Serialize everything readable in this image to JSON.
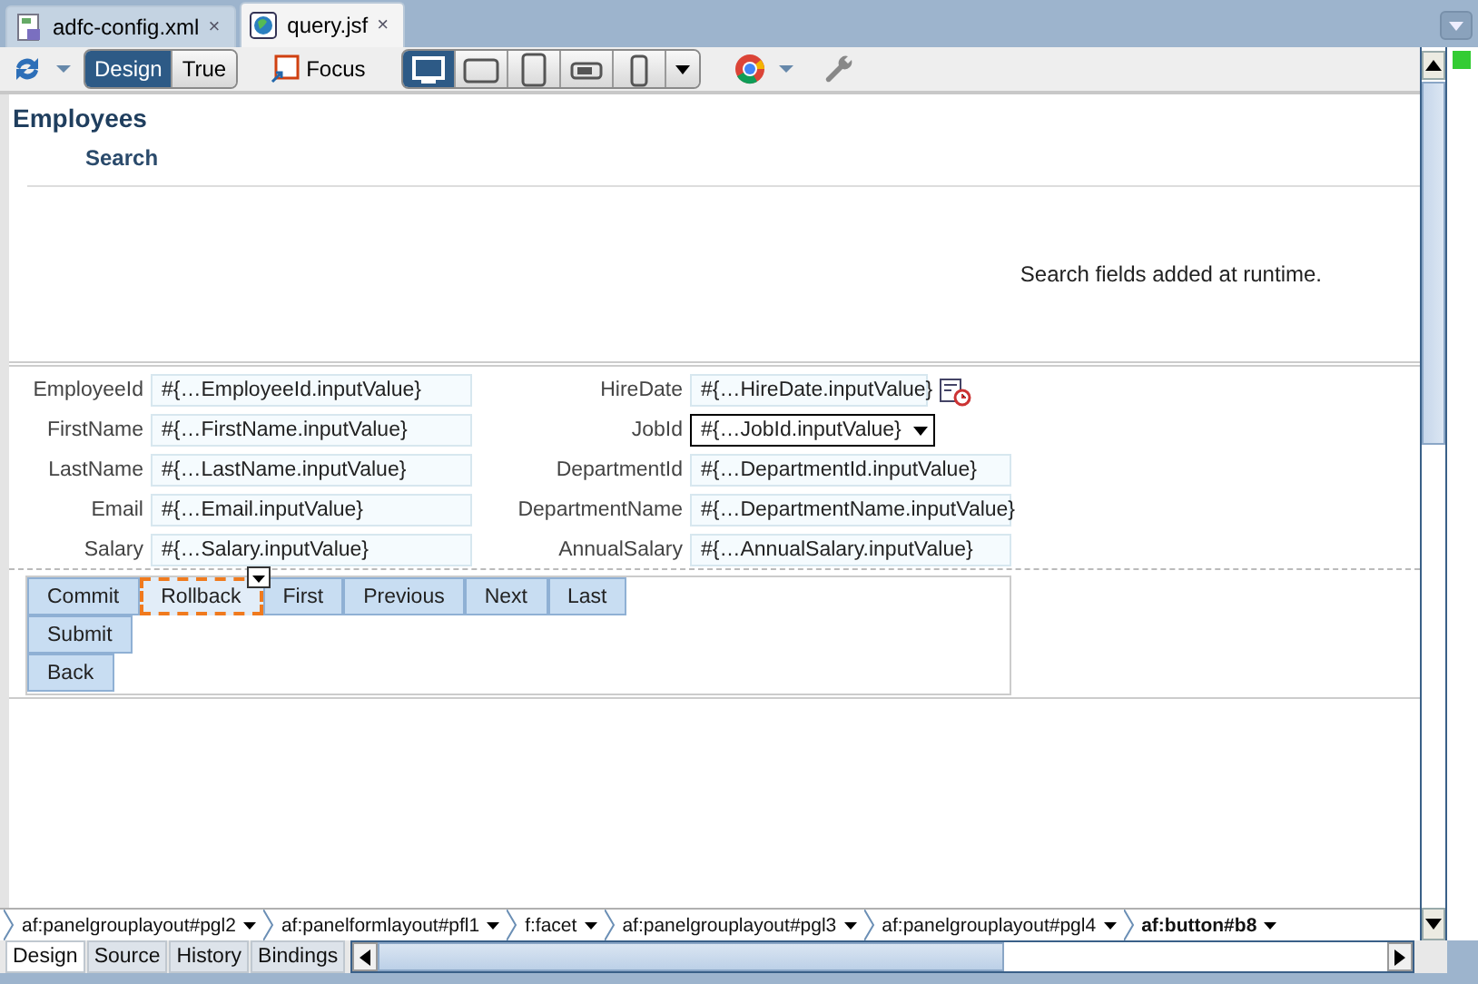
{
  "tabs": [
    {
      "label": "adfc-config.xml",
      "kind": "xml",
      "selected": false,
      "close": "×"
    },
    {
      "label": "query.jsf",
      "kind": "jsf",
      "selected": true,
      "close": "×"
    }
  ],
  "toolbar": {
    "modes": [
      {
        "label": "Design",
        "selected": true
      },
      {
        "label": "True",
        "selected": false
      }
    ],
    "focus": "Focus",
    "devices": [
      {
        "kind": "desktop",
        "selected": true
      },
      {
        "kind": "tablet-landscape",
        "selected": false
      },
      {
        "kind": "tablet-portrait",
        "selected": false
      },
      {
        "kind": "phone-landscape",
        "selected": false
      },
      {
        "kind": "phone-portrait",
        "selected": false
      }
    ]
  },
  "page": {
    "title": "Employees",
    "section": "Search",
    "search_note": "Search fields added at runtime.",
    "fields_left": [
      {
        "label": "EmployeeId",
        "value": "#{…EmployeeId.inputValue}",
        "kind": "text"
      },
      {
        "label": "FirstName",
        "value": "#{…FirstName.inputValue}",
        "kind": "text"
      },
      {
        "label": "LastName",
        "value": "#{…LastName.inputValue}",
        "kind": "text"
      },
      {
        "label": "Email",
        "value": "#{…Email.inputValue}",
        "kind": "text"
      },
      {
        "label": "Salary",
        "value": "#{…Salary.inputValue}",
        "kind": "text"
      }
    ],
    "fields_right": [
      {
        "label": "HireDate",
        "value": "#{…HireDate.inputValue}",
        "kind": "date"
      },
      {
        "label": "JobId",
        "value": "#{…JobId.inputValue}",
        "kind": "select"
      },
      {
        "label": "DepartmentId",
        "value": "#{…DepartmentId.inputValue}",
        "kind": "text"
      },
      {
        "label": "DepartmentName",
        "value": "#{…DepartmentName.inputValue}",
        "kind": "text"
      },
      {
        "label": "AnnualSalary",
        "value": "#{…AnnualSalary.inputValue}",
        "kind": "text"
      }
    ],
    "buttons_row": [
      {
        "label": "Commit",
        "focused": false
      },
      {
        "label": "Rollback",
        "focused": true
      },
      {
        "label": "First",
        "focused": false
      },
      {
        "label": "Previous",
        "focused": false
      },
      {
        "label": "Next",
        "focused": false
      },
      {
        "label": "Last",
        "focused": false
      }
    ],
    "buttons_column": [
      {
        "label": "Submit"
      },
      {
        "label": "Back"
      }
    ]
  },
  "breadcrumbs": [
    {
      "label": "af:panelgrouplayout#pgl2",
      "selected": false
    },
    {
      "label": "af:panelformlayout#pfl1",
      "selected": false
    },
    {
      "label": "f:facet",
      "selected": false
    },
    {
      "label": "af:panelgrouplayout#pgl3",
      "selected": false
    },
    {
      "label": "af:panelgrouplayout#pgl4",
      "selected": false
    },
    {
      "label": "af:button#b8",
      "selected": true
    }
  ],
  "bottom_tabs": [
    {
      "label": "Design",
      "selected": true
    },
    {
      "label": "Source",
      "selected": false
    },
    {
      "label": "History",
      "selected": false
    },
    {
      "label": "Bindings",
      "selected": false
    }
  ]
}
